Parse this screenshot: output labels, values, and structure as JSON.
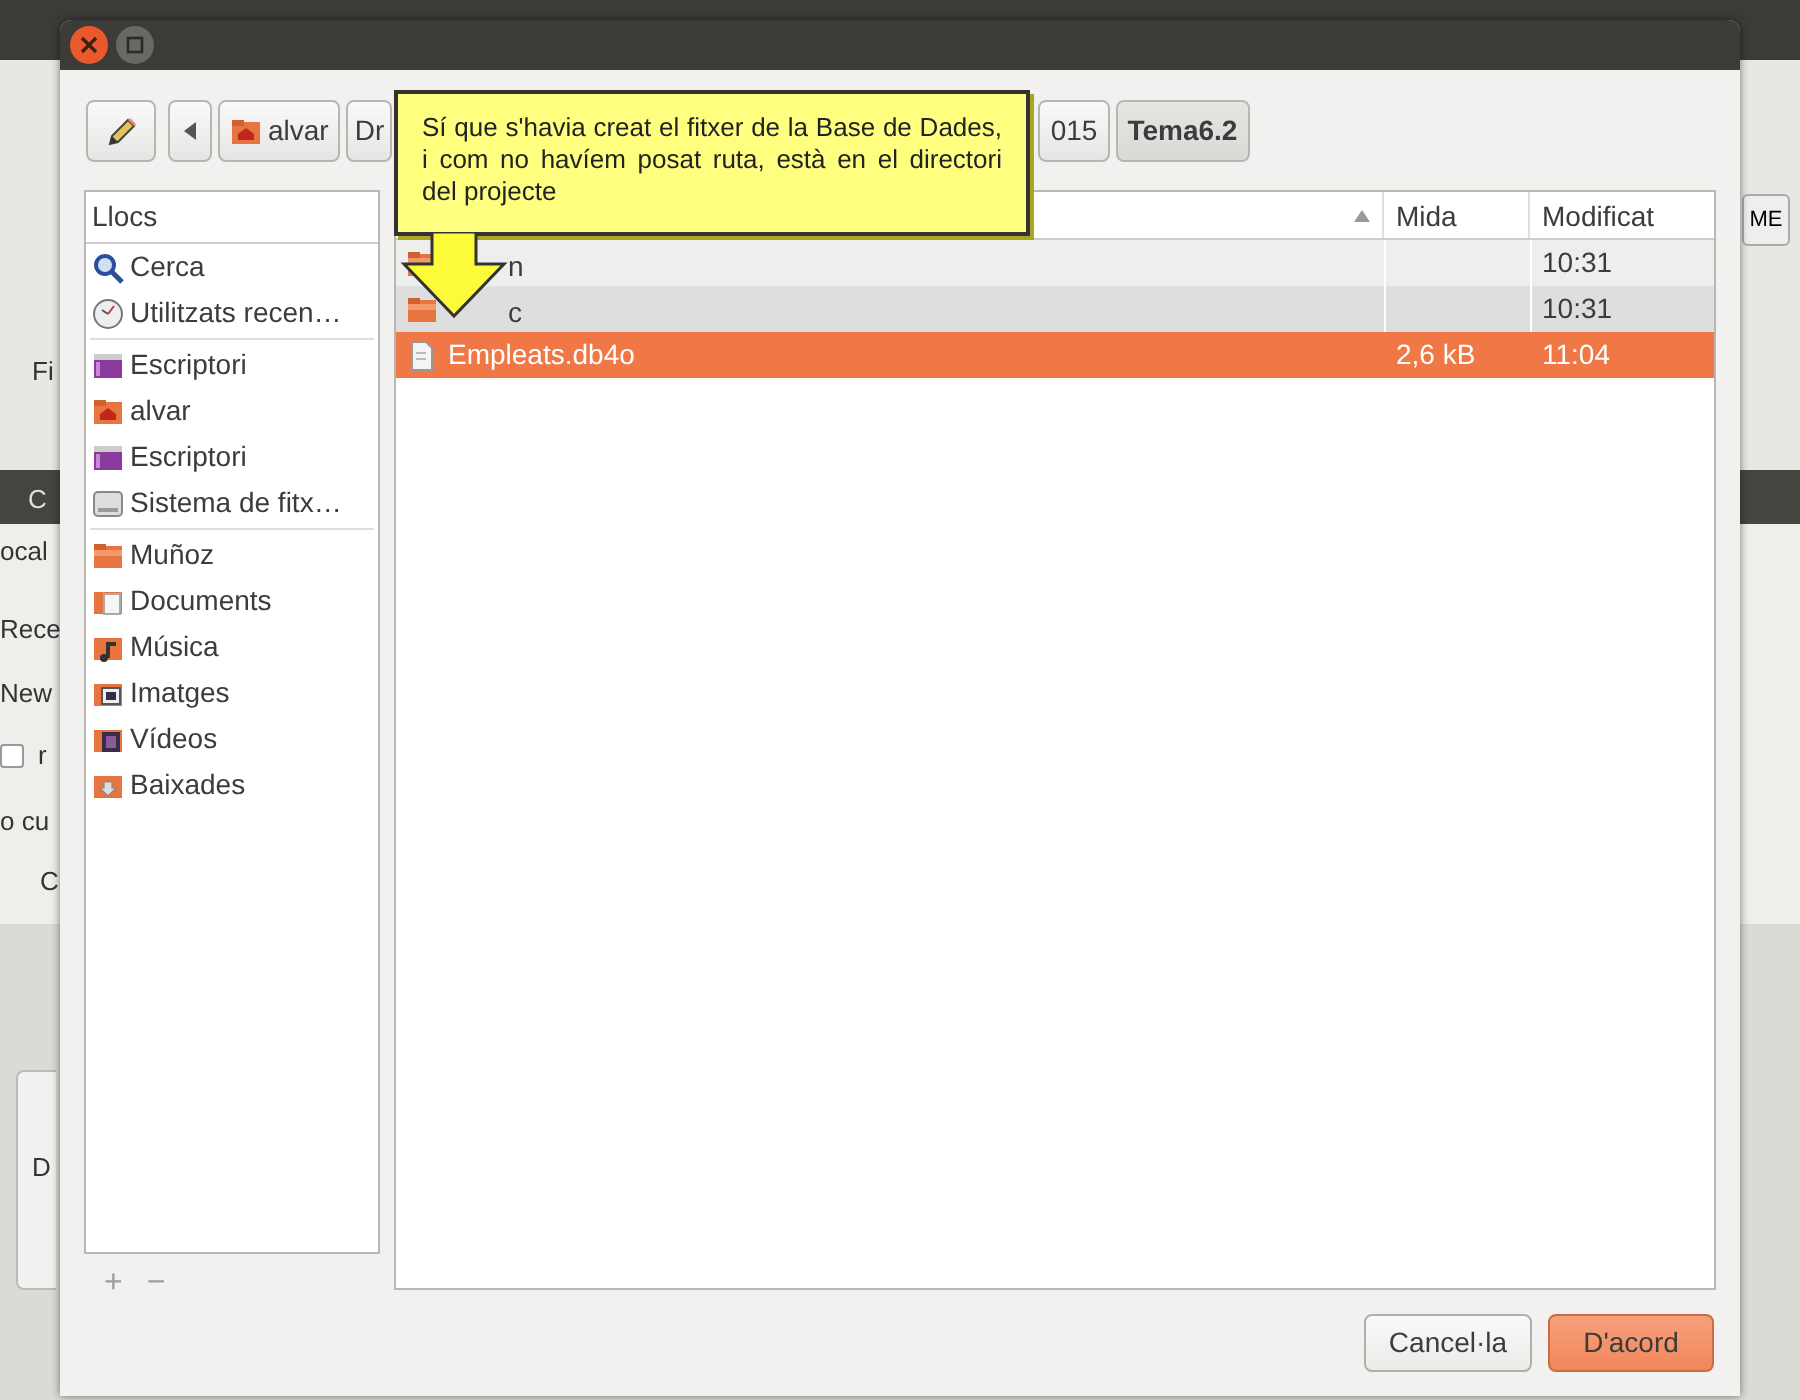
{
  "background": {
    "left_texts": [
      {
        "text": "Fi",
        "kind": "label"
      },
      {
        "text": "C",
        "kind": "title"
      },
      {
        "text": "ocal",
        "kind": "tab"
      },
      {
        "text": "Rece",
        "kind": "label"
      },
      {
        "text": "New",
        "kind": "label"
      },
      {
        "text": "r",
        "kind": "checkbox",
        "checked": false
      },
      {
        "text": "o cu",
        "kind": "label"
      },
      {
        "text": "C",
        "kind": "label"
      },
      {
        "text": "D",
        "kind": "label"
      }
    ],
    "right_button": "ME"
  },
  "dialog": {
    "path": [
      {
        "label": "alvar",
        "kind": "home",
        "selected": false
      },
      {
        "label": "Dr",
        "kind": "plain",
        "selected": false
      },
      {
        "label": "015",
        "kind": "plain",
        "selected": false
      },
      {
        "label": "Tema6.2",
        "kind": "plain",
        "selected": true
      }
    ],
    "places_title": "Llocs",
    "place_groups": [
      [
        {
          "label": "Cerca",
          "kind": "search"
        },
        {
          "label": "Utilitzats recen…",
          "kind": "recent"
        }
      ],
      [
        {
          "label": "Escriptori",
          "kind": "desktop"
        },
        {
          "label": "alvar",
          "kind": "home"
        },
        {
          "label": "Escriptori",
          "kind": "desktop"
        },
        {
          "label": "Sistema de fitx…",
          "kind": "drive"
        }
      ],
      [
        {
          "label": "Muñoz",
          "kind": "folder"
        },
        {
          "label": "Documents",
          "kind": "documents"
        },
        {
          "label": "Música",
          "kind": "music"
        },
        {
          "label": "Imatges",
          "kind": "pictures"
        },
        {
          "label": "Vídeos",
          "kind": "videos"
        },
        {
          "label": "Baixades",
          "kind": "downloads"
        }
      ]
    ],
    "place_actions": [
      {
        "label": "+",
        "disabled": true
      },
      {
        "label": "−",
        "disabled": true
      }
    ],
    "columns": [
      {
        "label": "Mida"
      },
      {
        "label": "Modificat"
      }
    ],
    "files": [
      {
        "name": "n",
        "kind": "folder",
        "modified": "10:31",
        "selected": false
      },
      {
        "name": "c",
        "kind": "folder",
        "modified": "10:31",
        "selected": false
      },
      {
        "name": "Empleats.db4o",
        "kind": "file",
        "size": "2,6 kB",
        "modified": "11:04",
        "selected": true
      }
    ],
    "buttons": [
      {
        "label": "Cancel·la",
        "kind": "secondary"
      },
      {
        "label": "D'acord",
        "kind": "primary"
      }
    ]
  },
  "callout": {
    "text": "Sí que s'havia creat el fitxer de la Base de Dades, i com no havíem posat ruta, està en el directori del projecte"
  }
}
